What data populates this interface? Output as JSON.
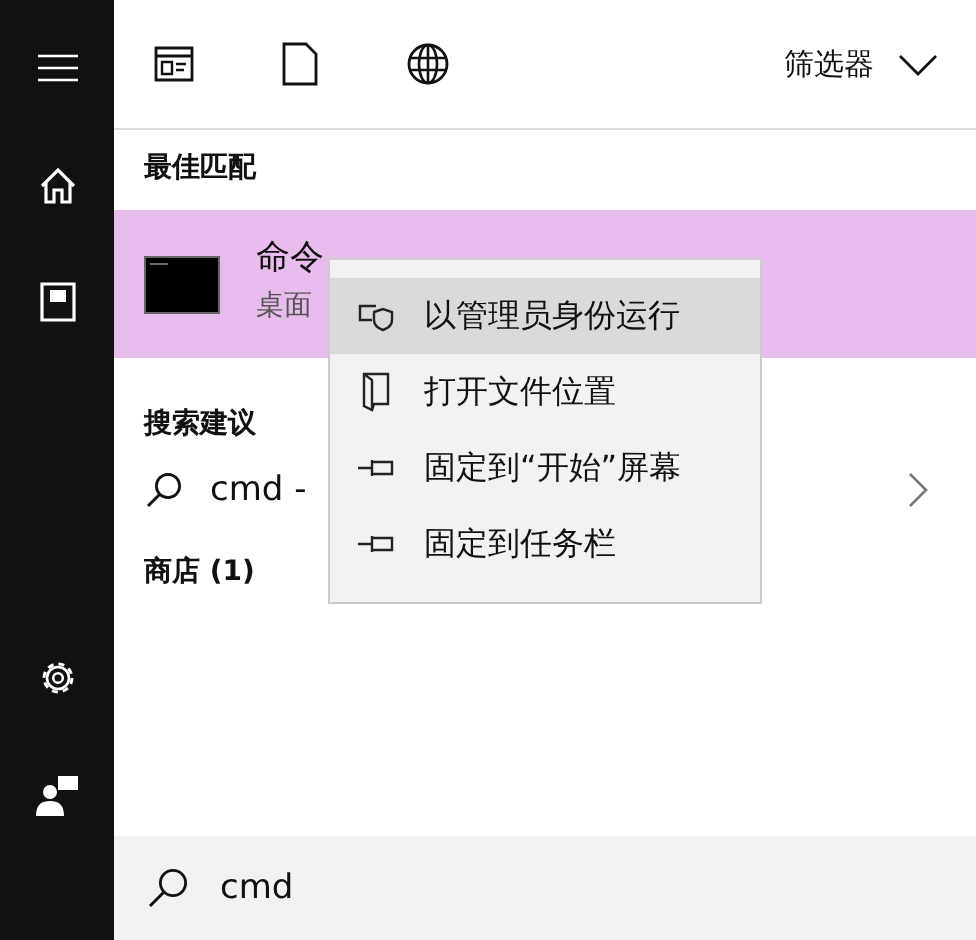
{
  "toolbar": {
    "filter_label": "筛选器"
  },
  "best_match": {
    "heading": "最佳匹配",
    "title": "命令",
    "subtitle": "桌面",
    "selected": true
  },
  "suggestions": {
    "heading": "搜索建议",
    "item": "cmd -"
  },
  "store": {
    "heading": "商店 (1)"
  },
  "context_menu": [
    {
      "label": "以管理员身份运行",
      "selected": true
    },
    {
      "label": "打开文件位置",
      "selected": false
    },
    {
      "label": "固定到“开始”屏幕",
      "selected": false
    },
    {
      "label": "固定到任务栏",
      "selected": false
    }
  ],
  "search": {
    "value": "cmd"
  }
}
